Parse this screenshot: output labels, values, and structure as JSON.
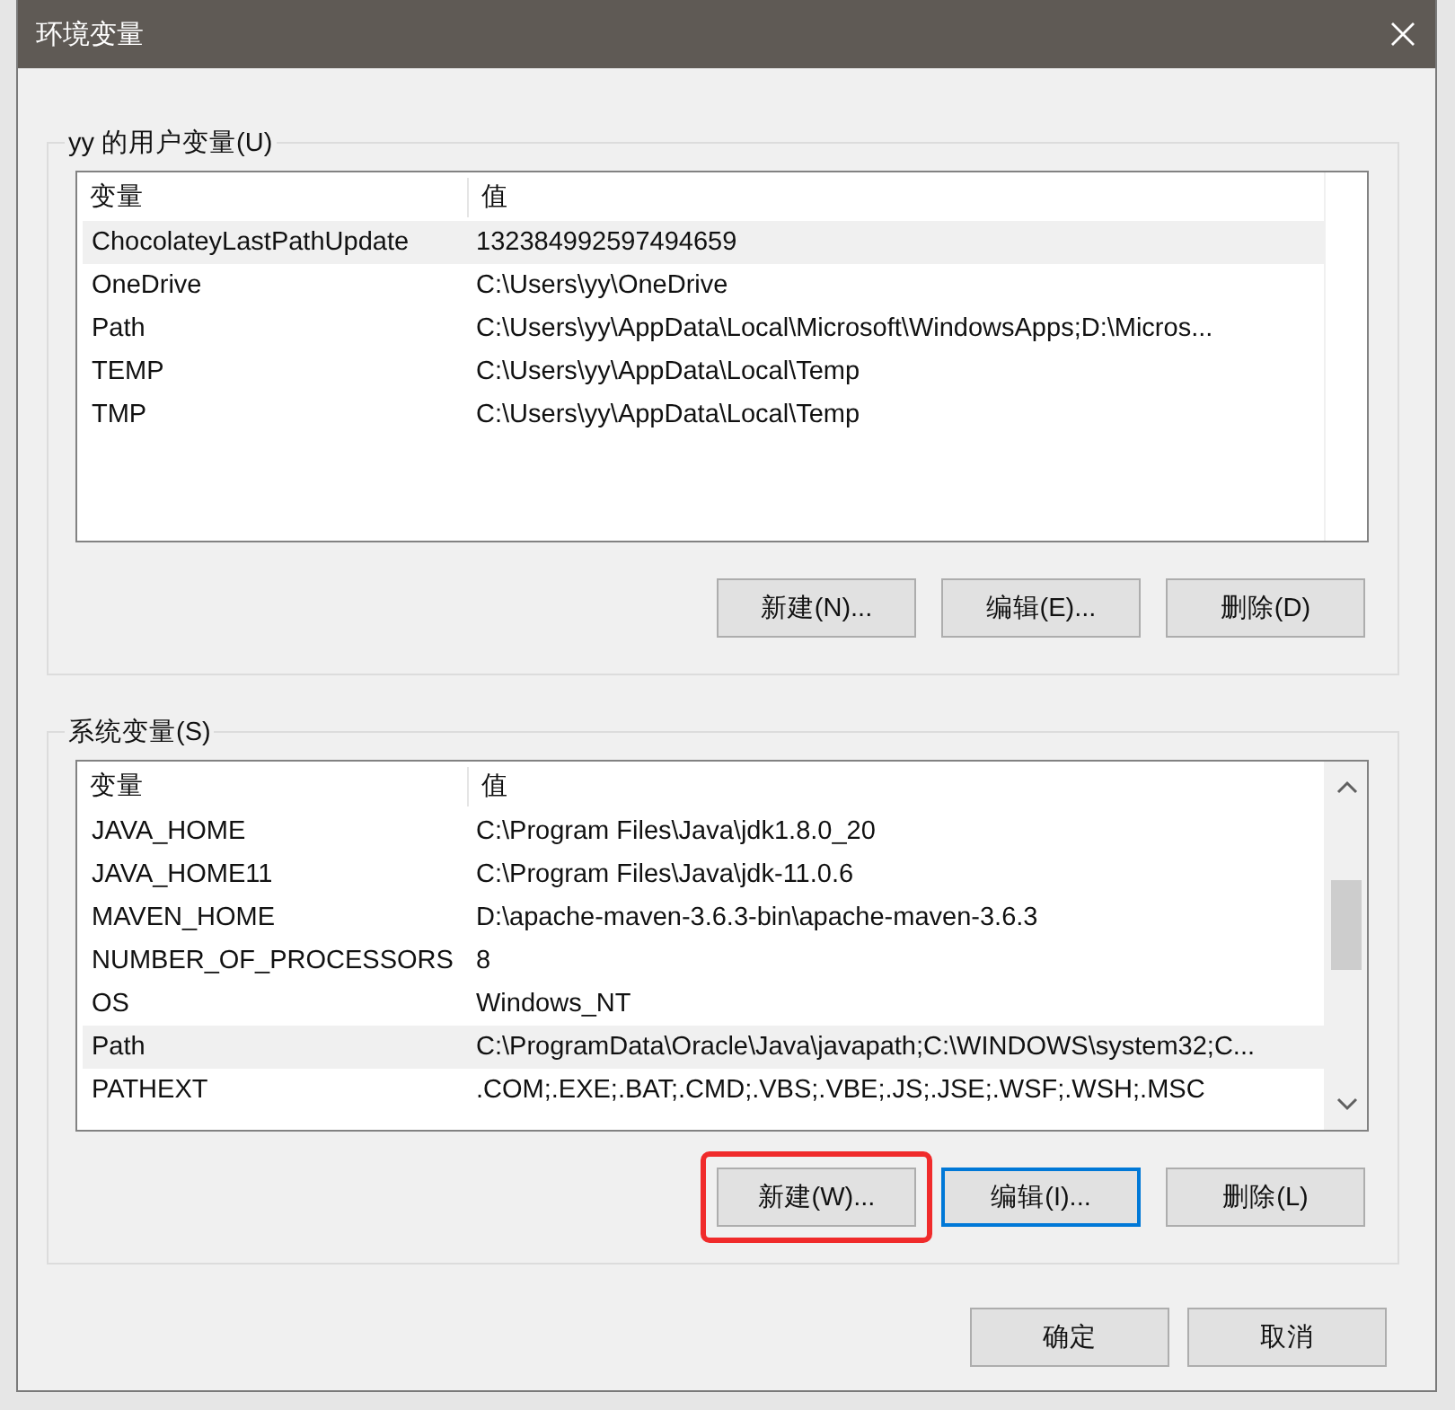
{
  "window": {
    "title": "环境变量"
  },
  "user_vars": {
    "title": "yy 的用户变量(U)",
    "columns": [
      "变量",
      "值"
    ],
    "rows": [
      {
        "name": "ChocolateyLastPathUpdate",
        "value": "132384992597494659",
        "selected": true
      },
      {
        "name": "OneDrive",
        "value": "C:\\Users\\yy\\OneDrive",
        "selected": false
      },
      {
        "name": "Path",
        "value": "C:\\Users\\yy\\AppData\\Local\\Microsoft\\WindowsApps;D:\\Micros...",
        "selected": false
      },
      {
        "name": "TEMP",
        "value": "C:\\Users\\yy\\AppData\\Local\\Temp",
        "selected": false
      },
      {
        "name": "TMP",
        "value": "C:\\Users\\yy\\AppData\\Local\\Temp",
        "selected": false
      }
    ],
    "buttons": [
      {
        "label": "新建(N)...",
        "focused": false,
        "highlighted": false
      },
      {
        "label": "编辑(E)...",
        "focused": false,
        "highlighted": false
      },
      {
        "label": "删除(D)",
        "focused": false,
        "highlighted": false
      }
    ]
  },
  "system_vars": {
    "title": "系统变量(S)",
    "columns": [
      "变量",
      "值"
    ],
    "rows": [
      {
        "name": "JAVA_HOME",
        "value": "C:\\Program Files\\Java\\jdk1.8.0_20",
        "selected": false
      },
      {
        "name": "JAVA_HOME11",
        "value": "C:\\Program Files\\Java\\jdk-11.0.6",
        "selected": false
      },
      {
        "name": "MAVEN_HOME",
        "value": "D:\\apache-maven-3.6.3-bin\\apache-maven-3.6.3",
        "selected": false
      },
      {
        "name": "NUMBER_OF_PROCESSORS",
        "value": "8",
        "selected": false
      },
      {
        "name": "OS",
        "value": "Windows_NT",
        "selected": false
      },
      {
        "name": "Path",
        "value": "C:\\ProgramData\\Oracle\\Java\\javapath;C:\\WINDOWS\\system32;C...",
        "selected": true
      },
      {
        "name": "PATHEXT",
        "value": ".COM;.EXE;.BAT;.CMD;.VBS;.VBE;.JS;.JSE;.WSF;.WSH;.MSC",
        "selected": false
      }
    ],
    "buttons": [
      {
        "label": "新建(W)...",
        "focused": false,
        "highlighted": true
      },
      {
        "label": "编辑(I)...",
        "focused": true,
        "highlighted": false
      },
      {
        "label": "删除(L)",
        "focused": false,
        "highlighted": false
      }
    ]
  },
  "footer_buttons": [
    {
      "label": "确定"
    },
    {
      "label": "取消"
    }
  ]
}
